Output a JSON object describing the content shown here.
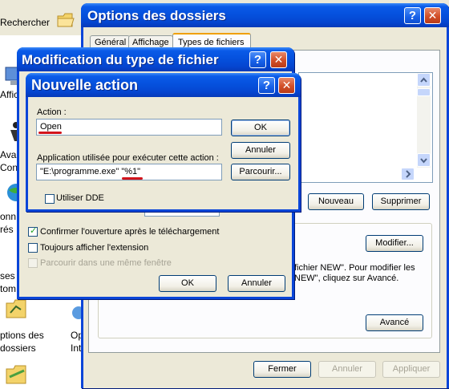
{
  "explorer": {
    "search_label": "Rechercher",
    "desktop_items": [
      {
        "label": "Affic"
      },
      {
        "label": "Ava"
      },
      {
        "label": "Con"
      },
      {
        "label": "onn"
      },
      {
        "label": "rés"
      },
      {
        "label": "ses"
      },
      {
        "label": "tom"
      },
      {
        "label_line1": "ptions des",
        "label_line2": "dossiers"
      },
      {
        "label_line1": "Op",
        "label_line2": "Int"
      }
    ]
  },
  "folder_options": {
    "title": "Options des dossiers",
    "tabs": [
      "Général",
      "Affichage",
      "Types de fichiers"
    ],
    "new_label": "Nouveau",
    "delete_label": "Supprimer",
    "modify_label": "Modifier...",
    "info_text_line1": "fichier NEW\". Pour modifier les",
    "info_text_line2": "NEW\", cliquez sur Avancé.",
    "advanced_label": "Avancé",
    "close_label": "Fermer",
    "cancel_label": "Annuler",
    "apply_label": "Appliquer"
  },
  "edit_file_type": {
    "title": "Modification du type de fichier",
    "confirm_open_label": "Confirmer l'ouverture après le téléchargement",
    "confirm_open_checked": true,
    "always_show_ext_label": "Toujours afficher l'extension",
    "always_show_ext_checked": false,
    "browse_same_window_label": "Parcourir dans une même fenêtre",
    "ok_label": "OK",
    "cancel_label": "Annuler"
  },
  "new_action": {
    "title": "Nouvelle action",
    "action_label": "Action :",
    "action_value": "Open",
    "app_label": "Application utilisée pour exécuter cette action :",
    "app_value": "\"E:\\programme.exe\" \"%1\"",
    "dde_label": "Utiliser DDE",
    "dde_checked": false,
    "ok_label": "OK",
    "cancel_label": "Annuler",
    "browse_label": "Parcourir..."
  },
  "titlebar_buttons": {
    "help": "?",
    "close": "✕"
  },
  "colors": {
    "titlebar_blue": "#0550dc",
    "dialog_face": "#ece9d8",
    "annotation_red": "#d2141b",
    "close_button_red": "#d24f28"
  }
}
